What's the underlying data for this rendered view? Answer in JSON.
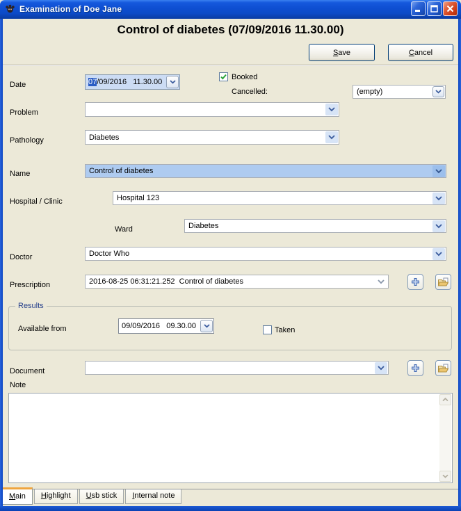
{
  "window": {
    "title": "Examination of Doe Jane",
    "icon": "paw-icon"
  },
  "header": {
    "title": "Control of diabetes (07/09/2016 11.30.00)",
    "save_label": "Save",
    "cancel_label": "Cancel"
  },
  "form": {
    "date": {
      "label": "Date",
      "value_selected": "07",
      "value_rest": "/09/2016   11.30.00"
    },
    "booked": {
      "label": "Booked",
      "checked": true
    },
    "cancelled": {
      "label": "Cancelled:",
      "value": "(empty)"
    },
    "problem": {
      "label": "Problem",
      "value": ""
    },
    "pathology": {
      "label": "Pathology",
      "value": "Diabetes"
    },
    "name": {
      "label": "Name",
      "value": "Control of diabetes"
    },
    "hospital": {
      "label": "Hospital / Clinic",
      "value": "Hospital 123"
    },
    "ward": {
      "label": "Ward",
      "value": "Diabetes"
    },
    "doctor": {
      "label": "Doctor",
      "value": "Doctor Who"
    },
    "prescription": {
      "label": "Prescription",
      "value": "2016-08-25 06:31:21.252  Control of diabetes"
    },
    "results": {
      "legend": "Results",
      "available_from": {
        "label": "Available from",
        "value": "09/09/2016   09.30.00"
      },
      "taken": {
        "label": "Taken",
        "checked": false
      }
    },
    "document": {
      "label": "Document",
      "value": ""
    },
    "note": {
      "label": "Note",
      "value": ""
    }
  },
  "tabs": [
    {
      "label": "Main",
      "active": true
    },
    {
      "label": "Highlight",
      "active": false
    },
    {
      "label": "Usb stick",
      "active": false
    },
    {
      "label": "Internal note",
      "active": false
    }
  ],
  "icons": [
    "paw-icon",
    "minimize-icon",
    "maximize-icon",
    "close-icon",
    "chevron-down-icon",
    "plus-icon",
    "open-folder-icon",
    "check-icon",
    "scroll-up-icon",
    "scroll-down-icon"
  ],
  "colors": {
    "titlebar_blue": "#0e4fd2",
    "frame_blue": "#0c46c2",
    "background_tan": "#ece9d8",
    "selection_blue": "#2a5cc4",
    "field_selected_bg": "#aecbf0",
    "date_field_bg": "#ccdcf4",
    "tab_accent_orange": "#efa53f",
    "check_green": "#2aa339",
    "legend_blue": "#27418c",
    "close_red": "#cf3d17"
  }
}
